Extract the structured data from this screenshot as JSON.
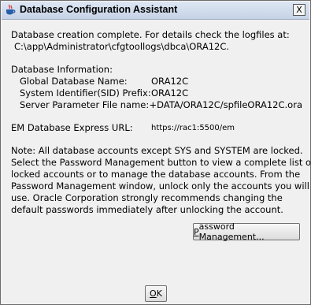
{
  "window": {
    "title": "Database Configuration Assistant",
    "close_symbol": "X",
    "icon": "java-coffee-icon"
  },
  "completion": {
    "message": "Database creation complete. For details check the logfiles at:",
    "log_path": "C:\\app\\Administrator\\cfgtoollogs\\dbca\\ORA12C."
  },
  "db_info": {
    "heading": "Database Information:",
    "rows": [
      {
        "label": "Global Database Name:",
        "value": "ORA12C"
      },
      {
        "label": "System Identifier(SID) Prefix:",
        "value": "ORA12C"
      },
      {
        "label": "Server Parameter File name:",
        "value": "+DATA/ORA12C/spfileORA12C.ora"
      }
    ]
  },
  "em": {
    "label": "EM Database Express URL:",
    "url": "https://rac1:5500/em"
  },
  "note": {
    "lines": [
      "Note: All database accounts except SYS and SYSTEM are locked.",
      "Select the Password Management button to view a complete list of",
      "locked accounts or to manage the database accounts. From the",
      "Password Management window, unlock only the accounts you will",
      "use. Oracle Corporation strongly recommends changing the",
      "default passwords immediately after unlocking the account."
    ]
  },
  "buttons": {
    "password_management": {
      "mnemonic": "P",
      "rest": "assword Management..."
    },
    "ok": {
      "mnemonic": "O",
      "rest": "K"
    }
  }
}
